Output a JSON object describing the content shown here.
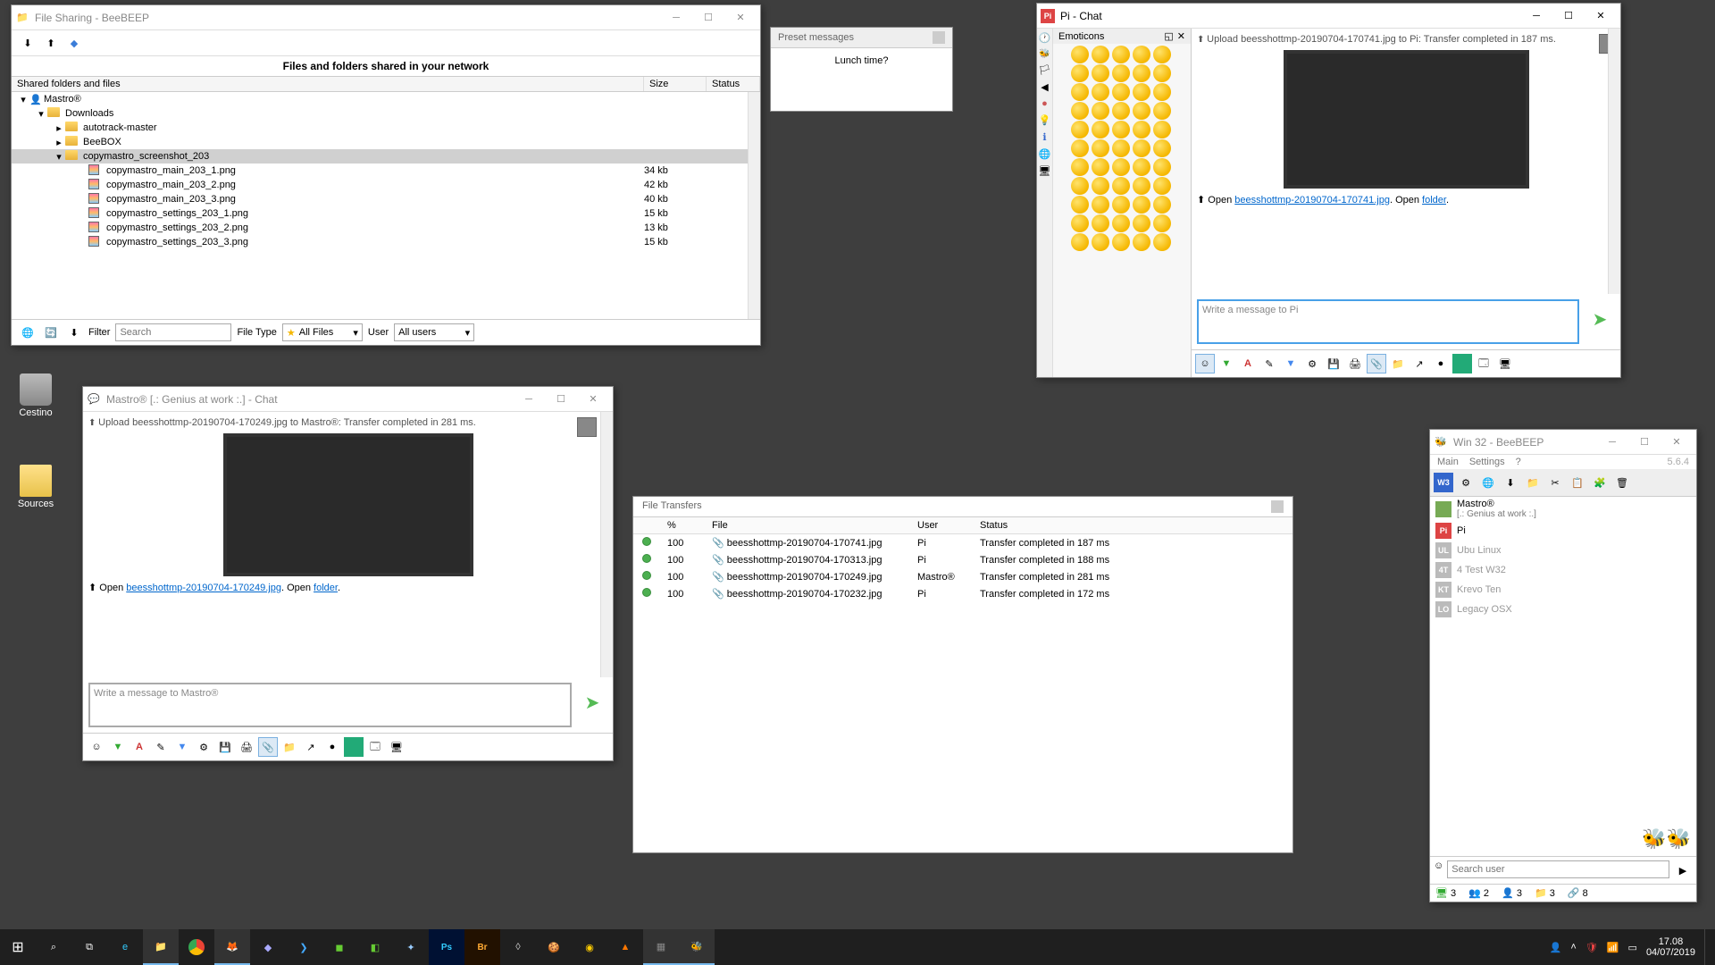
{
  "fileSharing": {
    "title": "File Sharing - BeeBEEP",
    "header": "Files and folders shared in your network",
    "columns": {
      "name": "Shared folders and files",
      "size": "Size",
      "status": "Status"
    },
    "rootUser": "Mastro®",
    "folders": {
      "downloads": "Downloads",
      "autotrack": "autotrack-master",
      "beebox": "BeeBOX",
      "screenshots": "copymastro_screenshot_203"
    },
    "files": [
      {
        "name": "copymastro_main_203_1.png",
        "size": "34 kb"
      },
      {
        "name": "copymastro_main_203_2.png",
        "size": "42 kb"
      },
      {
        "name": "copymastro_main_203_3.png",
        "size": "40 kb"
      },
      {
        "name": "copymastro_settings_203_1.png",
        "size": "15 kb"
      },
      {
        "name": "copymastro_settings_203_2.png",
        "size": "13 kb"
      },
      {
        "name": "copymastro_settings_203_3.png",
        "size": "15 kb"
      }
    ],
    "filterLabel": "Filter",
    "searchPlaceholder": "Search",
    "fileTypeLabel": "File Type",
    "fileTypeValue": "All Files",
    "userLabel": "User",
    "userValue": "All users"
  },
  "preset": {
    "title": "Preset messages",
    "message": "Lunch time?"
  },
  "piChat": {
    "title": "Pi - Chat",
    "emoticonsLabel": "Emoticons",
    "uploadMsg": "Upload beesshottmp-20190704-170741.jpg to Pi: Transfer completed in 187 ms.",
    "openLabel": "Open",
    "fileLink": "beesshottmp-20190704-170741.jpg",
    "openWord": ". Open ",
    "folderLink": "folder",
    "placeholder": "Write a message to Pi",
    "period": "."
  },
  "mastroChat": {
    "title": "Mastro® [.: Genius at work :.] - Chat",
    "uploadMsg": "Upload beesshottmp-20190704-170249.jpg to Mastro®: Transfer completed in 281 ms.",
    "openLabel": "Open",
    "fileLink": "beesshottmp-20190704-170249.jpg",
    "openWord": ". Open ",
    "folderLink": "folder",
    "placeholder": "Write a message to Mastro®",
    "period": "."
  },
  "fileTransfers": {
    "title": "File Transfers",
    "cols": {
      "pct": "%",
      "file": "File",
      "user": "User",
      "status": "Status"
    },
    "rows": [
      {
        "pct": "100",
        "file": "beesshottmp-20190704-170741.jpg",
        "user": "Pi",
        "status": "Transfer completed in 187 ms"
      },
      {
        "pct": "100",
        "file": "beesshottmp-20190704-170313.jpg",
        "user": "Pi",
        "status": "Transfer completed in 188 ms"
      },
      {
        "pct": "100",
        "file": "beesshottmp-20190704-170249.jpg",
        "user": "Mastro®",
        "status": "Transfer completed in 281 ms"
      },
      {
        "pct": "100",
        "file": "beesshottmp-20190704-170232.jpg",
        "user": "Pi",
        "status": "Transfer completed in 172 ms"
      }
    ]
  },
  "mainApp": {
    "title": "Win 32 - BeeBEEP",
    "version": "5.6.4",
    "menus": {
      "main": "Main",
      "settings": "Settings",
      "help": "?"
    },
    "users": [
      {
        "name": "Mastro®",
        "status": "[.: Genius at work :.]",
        "badge": "",
        "color": "#7a5",
        "online": true,
        "avatar": true
      },
      {
        "name": "Pi",
        "badge": "Pi",
        "color": "#d44",
        "online": true,
        "avatar": true
      },
      {
        "name": "Ubu Linux",
        "badge": "UL",
        "color": "#aaa",
        "online": false
      },
      {
        "name": "4 Test W32",
        "badge": "4T",
        "color": "#aaa",
        "online": false
      },
      {
        "name": "Krevo Ten",
        "badge": "KT",
        "color": "#aaa",
        "online": false
      },
      {
        "name": "Legacy OSX",
        "badge": "LO",
        "color": "#aaa",
        "online": false
      }
    ],
    "searchPlaceholder": "Search user",
    "counts": {
      "online": "3",
      "users": "2",
      "groups": "3",
      "files": "3",
      "other": "8"
    }
  },
  "desktop": {
    "trash": "Cestino",
    "sources": "Sources"
  },
  "tray": {
    "time": "17.08",
    "date": "04/07/2019"
  }
}
